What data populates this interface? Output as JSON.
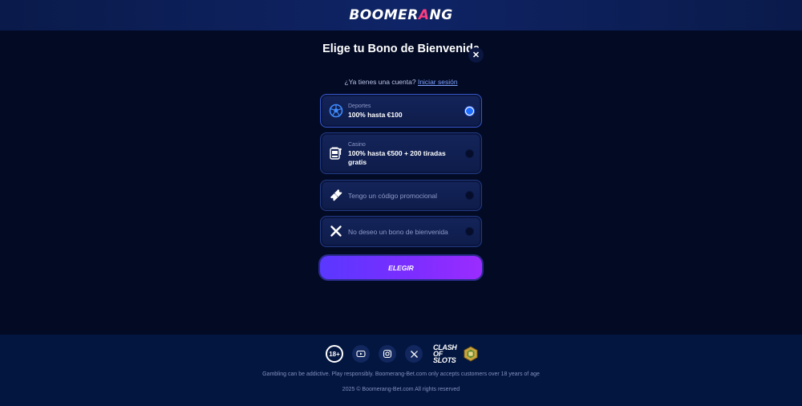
{
  "header": {
    "logo_main": "BOOMER",
    "logo_accent": "A",
    "logo_end": "NG"
  },
  "modal": {
    "title": "Elige tu Bono de Bienvenida",
    "close_icon": "close-icon",
    "login_prompt": "¿Ya tienes una cuenta?",
    "login_link": "Iniciar sesión",
    "options": [
      {
        "category": "Deportes",
        "title": "100% hasta €100",
        "icon": "soccer-ball-icon",
        "selected": true
      },
      {
        "category": "Casino",
        "title": "100% hasta €500 + 200 tiradas gratis",
        "icon": "slot-machine-icon",
        "selected": false
      },
      {
        "title": "Tengo un código promocional",
        "icon": "promo-ticket-icon",
        "selected": false
      },
      {
        "title": "No deseo un bono de bienvenida",
        "icon": "x-icon",
        "selected": false
      }
    ],
    "submit_label": "ELEGIR"
  },
  "footer": {
    "age_badge": "18+",
    "socials": [
      "youtube-icon",
      "instagram-icon",
      "x-twitter-icon"
    ],
    "partner_line1": "CLASH",
    "partner_line2": "OF SLOTS",
    "disclaimer": "Gambling can be addictive. Play responsibly. Boomerang-Bet.com only accepts customers over 18 years of age",
    "copyright": "2025 © Boomerang-Bet.com All rights reserved"
  },
  "colors": {
    "background": "#020a24",
    "accent": "#7b2dff",
    "brand_pink": "#ff3d7f",
    "radio_on": "#1b6cff"
  }
}
